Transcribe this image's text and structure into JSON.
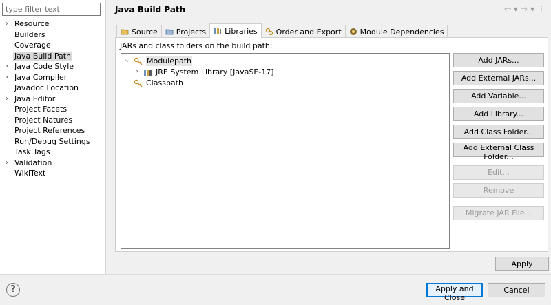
{
  "filter": {
    "placeholder": "type filter text",
    "value": ""
  },
  "sidebar": {
    "items": [
      {
        "label": "Resource",
        "expandable": true
      },
      {
        "label": "Builders",
        "expandable": false
      },
      {
        "label": "Coverage",
        "expandable": false
      },
      {
        "label": "Java Build Path",
        "expandable": false,
        "selected": true
      },
      {
        "label": "Java Code Style",
        "expandable": true
      },
      {
        "label": "Java Compiler",
        "expandable": true
      },
      {
        "label": "Javadoc Location",
        "expandable": false
      },
      {
        "label": "Java Editor",
        "expandable": true
      },
      {
        "label": "Project Facets",
        "expandable": false
      },
      {
        "label": "Project Natures",
        "expandable": false
      },
      {
        "label": "Project References",
        "expandable": false
      },
      {
        "label": "Run/Debug Settings",
        "expandable": false
      },
      {
        "label": "Task Tags",
        "expandable": false
      },
      {
        "label": "Validation",
        "expandable": true
      },
      {
        "label": "WikiText",
        "expandable": false
      }
    ]
  },
  "header": {
    "title": "Java Build Path"
  },
  "tabs": [
    {
      "label": "Source",
      "icon": "source-folder-icon"
    },
    {
      "label": "Projects",
      "icon": "projects-icon"
    },
    {
      "label": "Libraries",
      "icon": "libraries-icon",
      "active": true
    },
    {
      "label": "Order and Export",
      "icon": "order-export-icon"
    },
    {
      "label": "Module Dependencies",
      "icon": "module-icon"
    }
  ],
  "libraries": {
    "caption": "JARs and class folders on the build path:",
    "tree": [
      {
        "label": "Modulepath",
        "expanded": true,
        "level": 0,
        "selected": true
      },
      {
        "label": "JRE System Library [JavaSE-17]",
        "expanded": false,
        "level": 1
      },
      {
        "label": "Classpath",
        "level": 0
      }
    ],
    "buttons": [
      {
        "label": "Add JARs...",
        "enabled": true
      },
      {
        "label": "Add External JARs...",
        "enabled": true
      },
      {
        "label": "Add Variable...",
        "enabled": true
      },
      {
        "label": "Add Library...",
        "enabled": true
      },
      {
        "label": "Add Class Folder...",
        "enabled": true
      },
      {
        "label": "Add External Class Folder...",
        "enabled": true
      },
      {
        "label": "Edit...",
        "enabled": false
      },
      {
        "label": "Remove",
        "enabled": false
      },
      {
        "label": "Migrate JAR File...",
        "enabled": false
      }
    ]
  },
  "apply_label": "Apply",
  "footer": {
    "help": "?",
    "apply_close_label": "Apply and Close",
    "cancel_label": "Cancel"
  }
}
